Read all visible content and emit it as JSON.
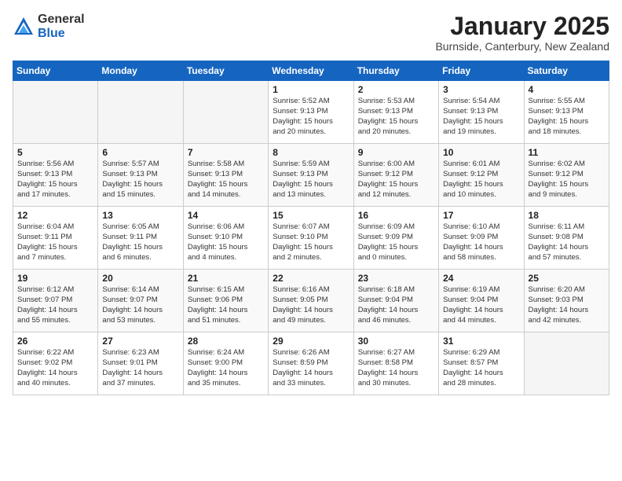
{
  "logo": {
    "general": "General",
    "blue": "Blue"
  },
  "title": "January 2025",
  "subtitle": "Burnside, Canterbury, New Zealand",
  "days_header": [
    "Sunday",
    "Monday",
    "Tuesday",
    "Wednesday",
    "Thursday",
    "Friday",
    "Saturday"
  ],
  "weeks": [
    [
      {
        "num": "",
        "info": ""
      },
      {
        "num": "",
        "info": ""
      },
      {
        "num": "",
        "info": ""
      },
      {
        "num": "1",
        "info": "Sunrise: 5:52 AM\nSunset: 9:13 PM\nDaylight: 15 hours\nand 20 minutes."
      },
      {
        "num": "2",
        "info": "Sunrise: 5:53 AM\nSunset: 9:13 PM\nDaylight: 15 hours\nand 20 minutes."
      },
      {
        "num": "3",
        "info": "Sunrise: 5:54 AM\nSunset: 9:13 PM\nDaylight: 15 hours\nand 19 minutes."
      },
      {
        "num": "4",
        "info": "Sunrise: 5:55 AM\nSunset: 9:13 PM\nDaylight: 15 hours\nand 18 minutes."
      }
    ],
    [
      {
        "num": "5",
        "info": "Sunrise: 5:56 AM\nSunset: 9:13 PM\nDaylight: 15 hours\nand 17 minutes."
      },
      {
        "num": "6",
        "info": "Sunrise: 5:57 AM\nSunset: 9:13 PM\nDaylight: 15 hours\nand 15 minutes."
      },
      {
        "num": "7",
        "info": "Sunrise: 5:58 AM\nSunset: 9:13 PM\nDaylight: 15 hours\nand 14 minutes."
      },
      {
        "num": "8",
        "info": "Sunrise: 5:59 AM\nSunset: 9:13 PM\nDaylight: 15 hours\nand 13 minutes."
      },
      {
        "num": "9",
        "info": "Sunrise: 6:00 AM\nSunset: 9:12 PM\nDaylight: 15 hours\nand 12 minutes."
      },
      {
        "num": "10",
        "info": "Sunrise: 6:01 AM\nSunset: 9:12 PM\nDaylight: 15 hours\nand 10 minutes."
      },
      {
        "num": "11",
        "info": "Sunrise: 6:02 AM\nSunset: 9:12 PM\nDaylight: 15 hours\nand 9 minutes."
      }
    ],
    [
      {
        "num": "12",
        "info": "Sunrise: 6:04 AM\nSunset: 9:11 PM\nDaylight: 15 hours\nand 7 minutes."
      },
      {
        "num": "13",
        "info": "Sunrise: 6:05 AM\nSunset: 9:11 PM\nDaylight: 15 hours\nand 6 minutes."
      },
      {
        "num": "14",
        "info": "Sunrise: 6:06 AM\nSunset: 9:10 PM\nDaylight: 15 hours\nand 4 minutes."
      },
      {
        "num": "15",
        "info": "Sunrise: 6:07 AM\nSunset: 9:10 PM\nDaylight: 15 hours\nand 2 minutes."
      },
      {
        "num": "16",
        "info": "Sunrise: 6:09 AM\nSunset: 9:09 PM\nDaylight: 15 hours\nand 0 minutes."
      },
      {
        "num": "17",
        "info": "Sunrise: 6:10 AM\nSunset: 9:09 PM\nDaylight: 14 hours\nand 58 minutes."
      },
      {
        "num": "18",
        "info": "Sunrise: 6:11 AM\nSunset: 9:08 PM\nDaylight: 14 hours\nand 57 minutes."
      }
    ],
    [
      {
        "num": "19",
        "info": "Sunrise: 6:12 AM\nSunset: 9:07 PM\nDaylight: 14 hours\nand 55 minutes."
      },
      {
        "num": "20",
        "info": "Sunrise: 6:14 AM\nSunset: 9:07 PM\nDaylight: 14 hours\nand 53 minutes."
      },
      {
        "num": "21",
        "info": "Sunrise: 6:15 AM\nSunset: 9:06 PM\nDaylight: 14 hours\nand 51 minutes."
      },
      {
        "num": "22",
        "info": "Sunrise: 6:16 AM\nSunset: 9:05 PM\nDaylight: 14 hours\nand 49 minutes."
      },
      {
        "num": "23",
        "info": "Sunrise: 6:18 AM\nSunset: 9:04 PM\nDaylight: 14 hours\nand 46 minutes."
      },
      {
        "num": "24",
        "info": "Sunrise: 6:19 AM\nSunset: 9:04 PM\nDaylight: 14 hours\nand 44 minutes."
      },
      {
        "num": "25",
        "info": "Sunrise: 6:20 AM\nSunset: 9:03 PM\nDaylight: 14 hours\nand 42 minutes."
      }
    ],
    [
      {
        "num": "26",
        "info": "Sunrise: 6:22 AM\nSunset: 9:02 PM\nDaylight: 14 hours\nand 40 minutes."
      },
      {
        "num": "27",
        "info": "Sunrise: 6:23 AM\nSunset: 9:01 PM\nDaylight: 14 hours\nand 37 minutes."
      },
      {
        "num": "28",
        "info": "Sunrise: 6:24 AM\nSunset: 9:00 PM\nDaylight: 14 hours\nand 35 minutes."
      },
      {
        "num": "29",
        "info": "Sunrise: 6:26 AM\nSunset: 8:59 PM\nDaylight: 14 hours\nand 33 minutes."
      },
      {
        "num": "30",
        "info": "Sunrise: 6:27 AM\nSunset: 8:58 PM\nDaylight: 14 hours\nand 30 minutes."
      },
      {
        "num": "31",
        "info": "Sunrise: 6:29 AM\nSunset: 8:57 PM\nDaylight: 14 hours\nand 28 minutes."
      },
      {
        "num": "",
        "info": ""
      }
    ]
  ]
}
